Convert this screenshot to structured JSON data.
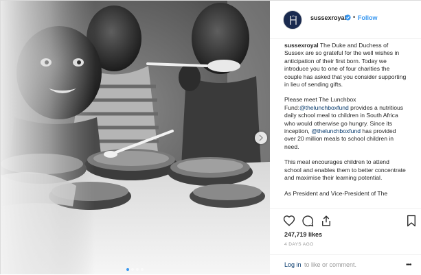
{
  "account": {
    "username": "sussexroyal",
    "follow_label": "Follow",
    "separator": "•"
  },
  "caption": {
    "p1_user": "sussexroyal",
    "p1_text": " The Duke and Duchess of Sussex are so grateful for the well wishes in anticipation of their first born. Today we introduce you to one of four charities the couple has asked that you consider supporting in lieu of sending gifts.",
    "p2_a": "Please meet The Lunchbox Fund:",
    "p2_mention1": "@thelunchboxfund",
    "p2_b": " provides a nutritious daily school meal to children in South Africa who would otherwise go hungry. Since its inception, ",
    "p2_mention2": "@thelunchboxfund",
    "p2_c": " has provided over 20 million meals to school children in need.",
    "p3": "This meal encourages children to attend school and enables them to better concentrate and maximise their learning potential.",
    "p4": "As President and Vice-President of The"
  },
  "engagement": {
    "likes": "247,719 likes",
    "timestamp": "4 DAYS AGO"
  },
  "comment_bar": {
    "login_link": "Log in",
    "login_rest": " to like or comment.",
    "more": "•••"
  },
  "icons": {
    "verified": "verified-badge-icon",
    "like": "heart-icon",
    "comment": "comment-icon",
    "share": "share-icon",
    "save": "bookmark-icon",
    "next": "chevron-right-icon"
  },
  "carousel": {
    "total": 4,
    "active_index": 0
  },
  "colors": {
    "link_blue": "#3897f0",
    "mention_blue": "#003569",
    "muted": "#999999",
    "text": "#262626",
    "avatar_navy": "#1a2a4f"
  }
}
